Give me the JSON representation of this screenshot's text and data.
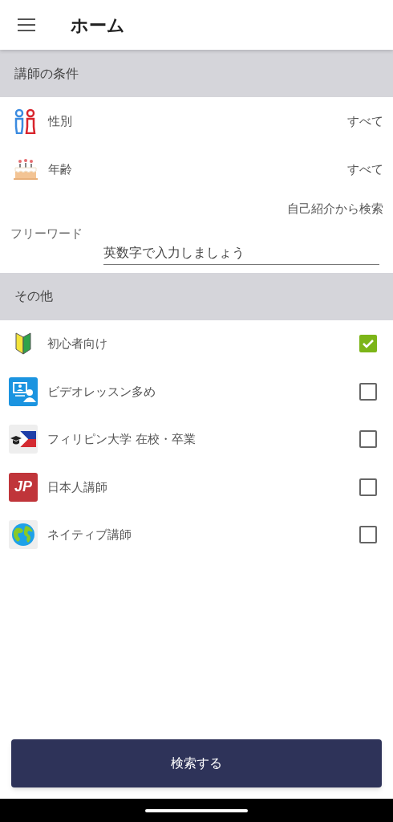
{
  "app_bar": {
    "title": "ホーム"
  },
  "teacher_section": {
    "title": "講師の条件",
    "filters": [
      {
        "kind": "gender",
        "label": "性別",
        "value": "すべて"
      },
      {
        "kind": "cake",
        "label": "年齢",
        "value": "すべて"
      }
    ],
    "intro_search_link": "自己紹介から検索",
    "free_word": {
      "label": "フリーワード",
      "placeholder": "英数字で入力しましょう"
    }
  },
  "other_section": {
    "title": "その他",
    "options": [
      {
        "kind": "beginner",
        "label": "初心者向け",
        "checked": true
      },
      {
        "kind": "video",
        "label": "ビデオレッスン多め",
        "checked": false
      },
      {
        "kind": "philippines",
        "label": "フィリピン大学 在校・卒業",
        "checked": false
      },
      {
        "kind": "jp",
        "icon_text": "JP",
        "label": "日本人講師",
        "checked": false
      },
      {
        "kind": "globe",
        "label": "ネイティブ講師",
        "checked": false
      }
    ]
  },
  "search_button": "検索する"
}
